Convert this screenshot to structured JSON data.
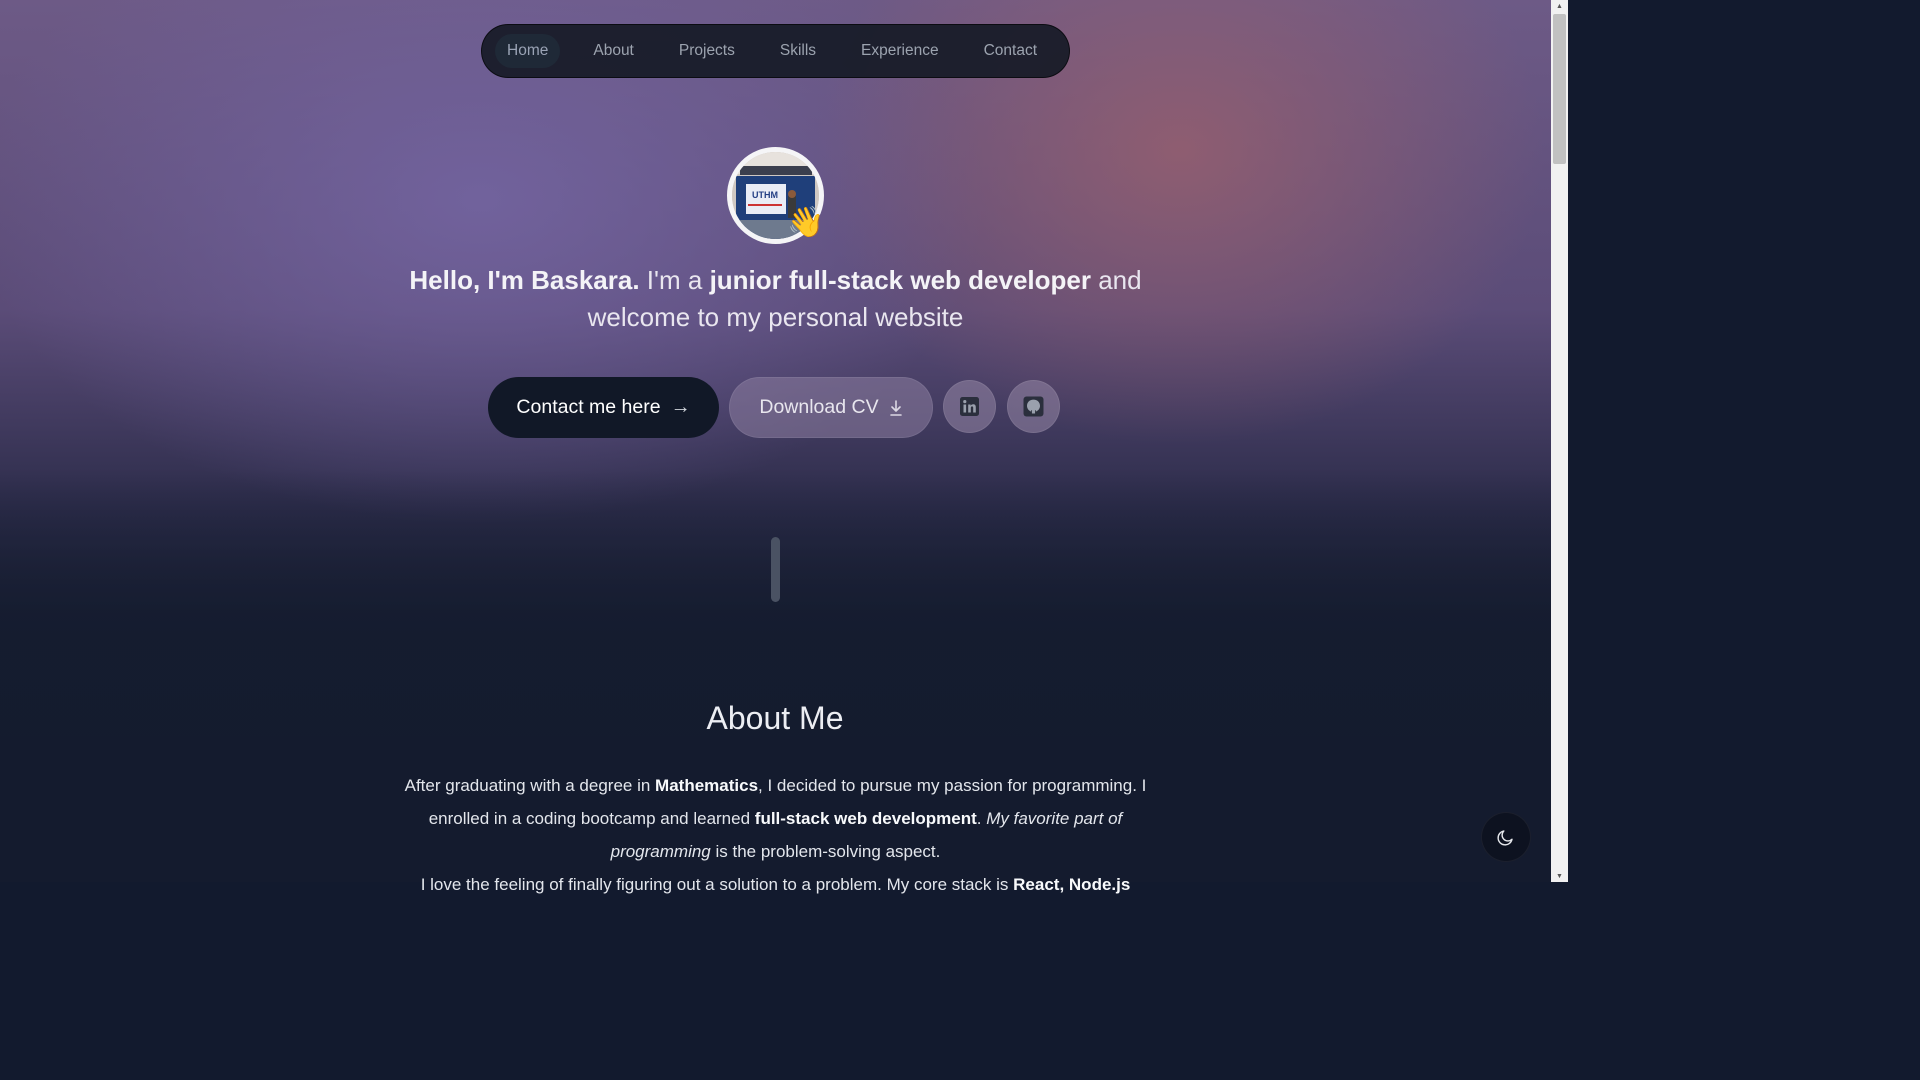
{
  "nav": {
    "items": [
      {
        "label": "Home",
        "active": true
      },
      {
        "label": "About"
      },
      {
        "label": "Projects"
      },
      {
        "label": "Skills"
      },
      {
        "label": "Experience"
      },
      {
        "label": "Contact"
      }
    ]
  },
  "hero": {
    "avatar_sign_text": "UTHM",
    "wave_emoji": "👋",
    "headline_1": "Hello, I'm Baskara.",
    "headline_2": " I'm a ",
    "headline_3": "junior full-stack web developer",
    "headline_4": " and welcome to my personal website",
    "contact_label": "Contact me here",
    "contact_arrow": "→",
    "cv_label": "Download CV",
    "linkedin_icon": "linkedin-icon",
    "github_icon": "github-icon"
  },
  "about": {
    "title": "About Me",
    "p1": "After graduating with a degree in ",
    "p2": "Mathematics",
    "p3": ", I decided to pursue my passion for programming. I enrolled in a coding bootcamp and learned ",
    "p4": "full-stack web development",
    "p5": ". ",
    "p6": "My favorite part of programming",
    "p7": " is the problem-solving aspect.",
    "p8": "I love the feeling of finally figuring out a solution to a problem. My core stack is ",
    "p9": "React, Node.js"
  },
  "theme_toggle_icon": "moon-icon",
  "colors": {
    "primary_button": "#111827",
    "page_background": "#141b2e"
  }
}
